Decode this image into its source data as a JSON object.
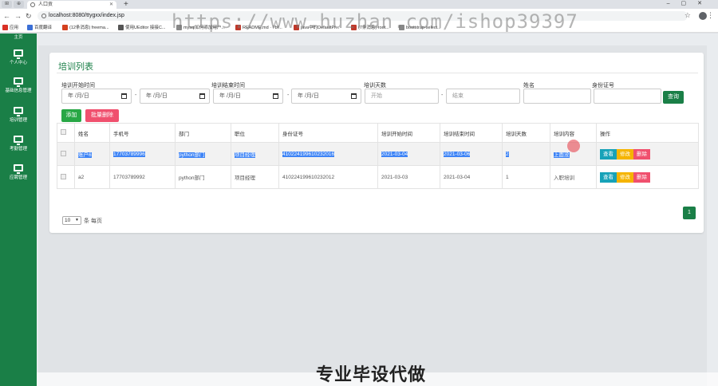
{
  "browser": {
    "tab_title": "人口贡",
    "url": "localhost:8080/ttygxx/index.jsp",
    "watermark": "https://www.huzhan.com/ishop39397",
    "bookmarks": [
      "应用",
      "百度翻译",
      "(12条消息) freema...",
      "使用UEditor 接接C...",
      "mysql如何添加用户...",
      "README.md · 7bf...",
      "java中的DefaultPr...",
      "(7条消息) root...",
      "bootstrap-select..."
    ]
  },
  "sidebar": {
    "top_label": "主页",
    "items": [
      {
        "label": "个人中心",
        "icon": "monitor-icon"
      },
      {
        "label": "基础信息管理",
        "icon": "monitor-icon"
      },
      {
        "label": "培训管理",
        "icon": "monitor-icon"
      },
      {
        "label": "考勤管理",
        "icon": "monitor-icon"
      },
      {
        "label": "应聘管理",
        "icon": "monitor-icon"
      }
    ]
  },
  "panel": {
    "title": "培训列表",
    "filters": {
      "start_label": "培训开始时间",
      "end_label": "培训结束时间",
      "days_label": "培训天数",
      "name_label": "姓名",
      "id_label": "身份证号",
      "date_placeholder": "年 /月/日",
      "days_from_placeholder": "开始",
      "days_to_placeholder": "结束",
      "dash": "-",
      "search_button": "查询"
    },
    "actions": {
      "add": "添加",
      "batch_delete": "批量删除"
    },
    "table": {
      "headers": [
        "",
        "姓名",
        "手机号",
        "部门",
        "职位",
        "身份证号",
        "培训开始时间",
        "培训结束时间",
        "培训天数",
        "培训内容",
        "操作"
      ],
      "rows": [
        {
          "name": "账户6",
          "phone": "17703789996",
          "dept": "python部门",
          "position": "项目经理",
          "idcard": "410224199610232016",
          "start": "2021-03-04",
          "end": "2021-03-06",
          "days": "2",
          "content": "上面没"
        },
        {
          "name": "a2",
          "phone": "17703789992",
          "dept": "python部门",
          "position": "项目经理",
          "idcard": "410224199610232012",
          "start": "2021-03-03",
          "end": "2021-03-04",
          "days": "1",
          "content": "入职培训"
        }
      ],
      "row_actions": {
        "view": "查看",
        "edit": "修改",
        "delete": "删除"
      }
    },
    "pager": {
      "page_size": "10",
      "per_page_text": "条 每页",
      "current_page": "1"
    }
  },
  "footer_banner": "专业毕设代做",
  "colors": {
    "brand_green": "#1a7f47",
    "add_green": "#28a745",
    "danger": "#f0506e",
    "info": "#17a2b8",
    "warning": "#f5b400",
    "selection": "#3e84f6"
  }
}
